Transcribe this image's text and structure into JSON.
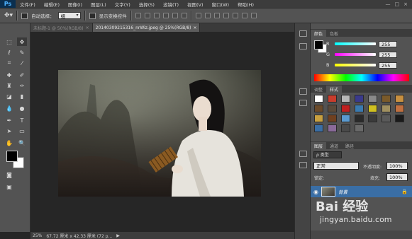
{
  "app": {
    "logo": "Ps"
  },
  "menubar": {
    "items": [
      "文件(F)",
      "编辑(E)",
      "图像(I)",
      "图层(L)",
      "文字(Y)",
      "选择(S)",
      "滤镜(T)",
      "视图(V)",
      "窗口(W)",
      "帮助(H)"
    ],
    "controls": [
      "—",
      "□",
      "×"
    ]
  },
  "options": {
    "auto_select_label": "自动选择：",
    "auto_select_value": "组",
    "show_transform_label": "显示变换控件"
  },
  "tabs": [
    {
      "label": "未标题-1 @ 50%(RGB/8)",
      "close": "×"
    },
    {
      "label": "20140309215316_nrWiz.jpeg @ 25%(RGB/8)",
      "close": "×"
    }
  ],
  "status": {
    "zoom": "25%",
    "doc_info": "67.72 厘米 x 42.33 厘米 (72 p..."
  },
  "color_panel": {
    "tabs": [
      "颜色",
      "色板"
    ],
    "channels": [
      {
        "label": "R",
        "value": "255",
        "gradient": "linear-gradient(to right,#00ffff,#ffffff)"
      },
      {
        "label": "G",
        "value": "255",
        "gradient": "linear-gradient(to right,#ff00ff,#ffffff)"
      },
      {
        "label": "B",
        "value": "255",
        "gradient": "linear-gradient(to right,#ffff00,#ffffff)"
      }
    ]
  },
  "style_panel": {
    "tabs": [
      "调整",
      "样式"
    ],
    "swatches": [
      "#ffffff",
      "#c83c2c",
      "#b8b8b8",
      "#3a3a8c",
      "#8a8a8a",
      "#7a5a2a",
      "#c89040",
      "#6a4a2a",
      "#5a4a3a",
      "#c02020",
      "#3a7ab0",
      "#d0c020",
      "#a09060",
      "#c07040",
      "#c8a040",
      "#704020",
      "#5a9ad0",
      "#2a2a2a",
      "#3a3a3a",
      "#5a5a5a",
      "#1a1a1a",
      "#3a6ea5",
      "#8a6a9a",
      "#4a4a4a",
      "#6a6a6a"
    ]
  },
  "layers_panel": {
    "tabs": [
      "图层",
      "通道",
      "路径"
    ],
    "filter_label": "ρ 类型",
    "blend_mode": "正常",
    "opacity_label": "不透明度:",
    "opacity_value": "100%",
    "lock_label": "锁定:",
    "fill_label": "填充:",
    "fill_value": "100%",
    "layer_name": "背景"
  },
  "watermark": {
    "text": "Bai 经验",
    "url": "jingyan.baidu.com"
  }
}
